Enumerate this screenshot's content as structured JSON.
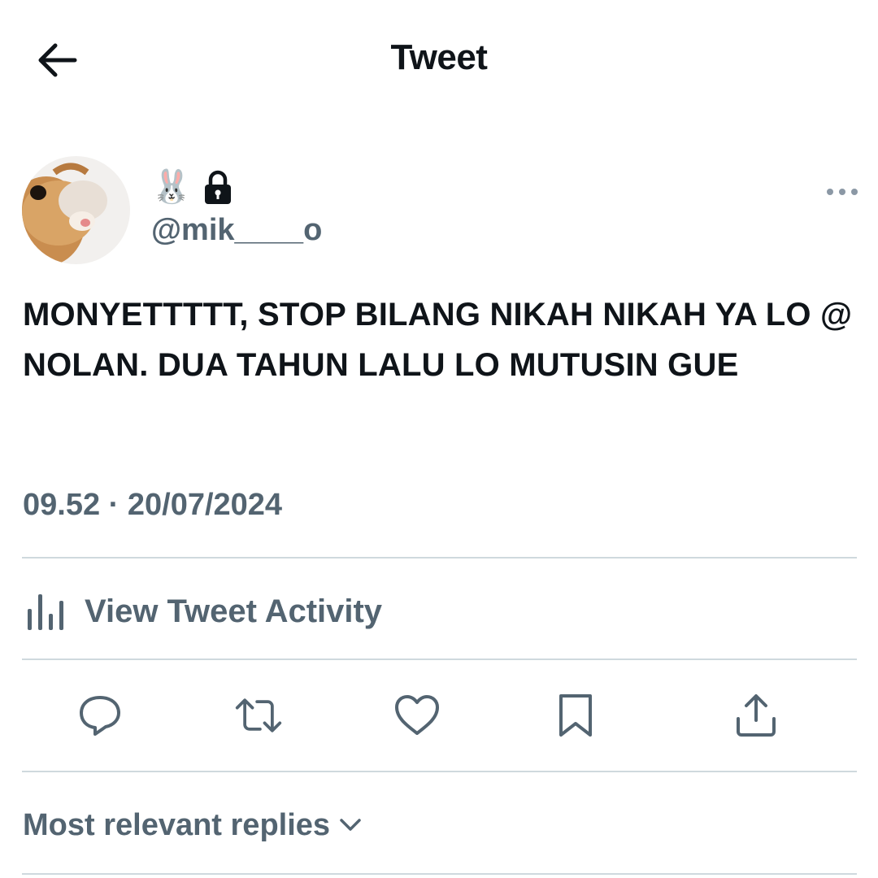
{
  "header": {
    "title": "Tweet"
  },
  "icons": {
    "back": "arrow-left-icon",
    "more": "more-horizontal-icon",
    "activity": "bar-chart-icon",
    "reply": "reply-icon",
    "retweet": "retweet-icon",
    "like": "heart-icon",
    "bookmark": "bookmark-icon",
    "share": "share-icon",
    "chevron": "chevron-down-icon"
  },
  "tweet": {
    "display_name_emoji": "🐰",
    "handle": "@mik____o",
    "text": "MONYETTTTT, STOP BILANG NIKAH NIKAH YA LO @ NOLAN. DUA TAHUN LALU LO MUTUSIN GUE",
    "timestamp": "09.52 · 20/07/2024"
  },
  "activity": {
    "label": "View Tweet Activity"
  },
  "replies": {
    "label": "Most relevant replies"
  },
  "colors": {
    "text": "#0f1419",
    "secondary": "#536471",
    "divider": "#cfd9de"
  }
}
